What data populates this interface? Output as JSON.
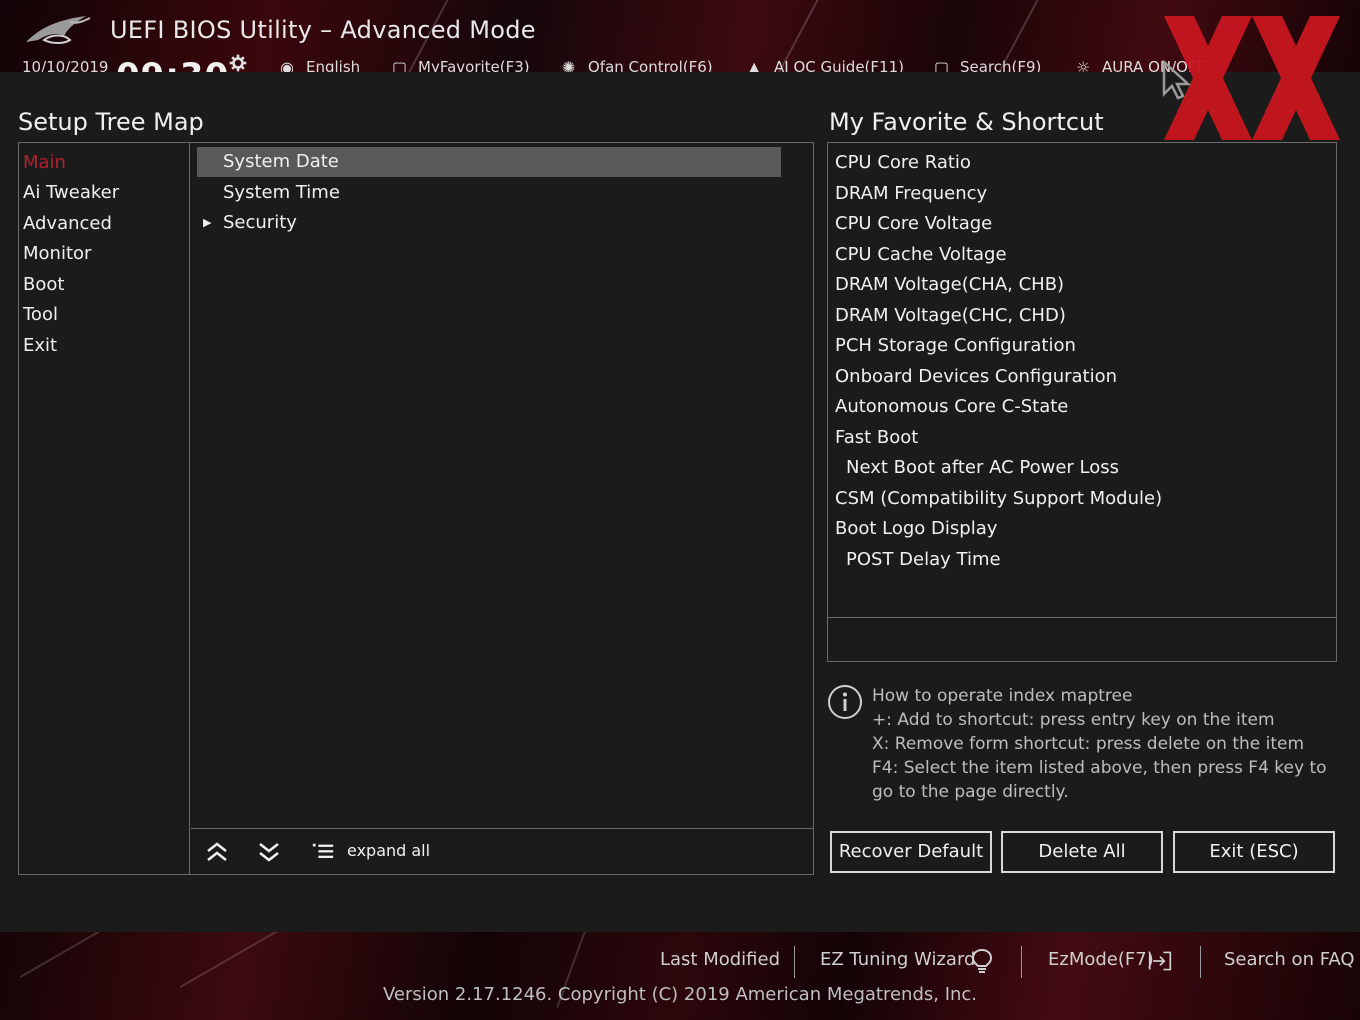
{
  "window": {
    "title": "UEFI BIOS Utility – Advanced Mode"
  },
  "toolbar": {
    "date": "10/10/2019",
    "time": "09:30",
    "items": [
      "English",
      "MyFavorite(F3)",
      "Qfan Control(F6)",
      "AI OC Guide(F11)",
      "Search(F9)",
      "AURA ON/OFF"
    ]
  },
  "tree": {
    "title": "Setup Tree Map",
    "menu": [
      "Main",
      "Ai Tweaker",
      "Advanced",
      "Monitor",
      "Boot",
      "Tool",
      "Exit"
    ],
    "active_menu": "Main",
    "items": [
      "System Date",
      "System Time",
      "Security"
    ],
    "selected_item": "System Date",
    "expand_label": "expand all"
  },
  "favorites": {
    "title": "My Favorite & Shortcut",
    "items": [
      {
        "label": "CPU Core Ratio",
        "indent": false
      },
      {
        "label": "DRAM Frequency",
        "indent": false
      },
      {
        "label": "CPU Core Voltage",
        "indent": false
      },
      {
        "label": "CPU Cache Voltage",
        "indent": false
      },
      {
        "label": "DRAM Voltage(CHA, CHB)",
        "indent": false
      },
      {
        "label": "DRAM Voltage(CHC, CHD)",
        "indent": false
      },
      {
        "label": "PCH Storage Configuration",
        "indent": false
      },
      {
        "label": "Onboard Devices Configuration",
        "indent": false
      },
      {
        "label": "Autonomous Core C-State",
        "indent": false
      },
      {
        "label": "Fast Boot",
        "indent": false
      },
      {
        "label": "Next Boot after AC Power Loss",
        "indent": true
      },
      {
        "label": "CSM (Compatibility Support Module)",
        "indent": false
      },
      {
        "label": "Boot Logo Display",
        "indent": false
      },
      {
        "label": "POST Delay Time",
        "indent": true
      }
    ]
  },
  "help": {
    "lines": [
      "How to operate index maptree",
      "+: Add to shortcut: press entry key on the item",
      "X: Remove form shortcut: press delete on the item",
      "F4: Select the item listed above, then press F4 key to",
      "go to the page directly."
    ]
  },
  "buttons": {
    "recover": "Recover Default",
    "delete_all": "Delete All",
    "exit": "Exit (ESC)"
  },
  "footer": {
    "last_modified": "Last Modified",
    "ez_tuning": "EZ Tuning Wizard",
    "ez_mode": "EzMode(F7)",
    "search_faq": "Search on FAQ",
    "version": "Version 2.17.1246. Copyright (C) 2019 American Megatrends, Inc."
  },
  "colors": {
    "accent_red": "#b4202c",
    "selected_bg": "#595959",
    "panel_bg": "#1b1b1b"
  },
  "icons": [
    "rog-logo",
    "gear-icon",
    "globe-icon",
    "favorite-icon",
    "fan-icon",
    "ai-oc-icon",
    "search-icon",
    "aura-icon",
    "mouse-cursor-icon",
    "double-chevron-up-icon",
    "double-chevron-down-icon",
    "expand-list-icon",
    "info-icon",
    "lightbulb-icon",
    "exit-arrow-icon"
  ]
}
